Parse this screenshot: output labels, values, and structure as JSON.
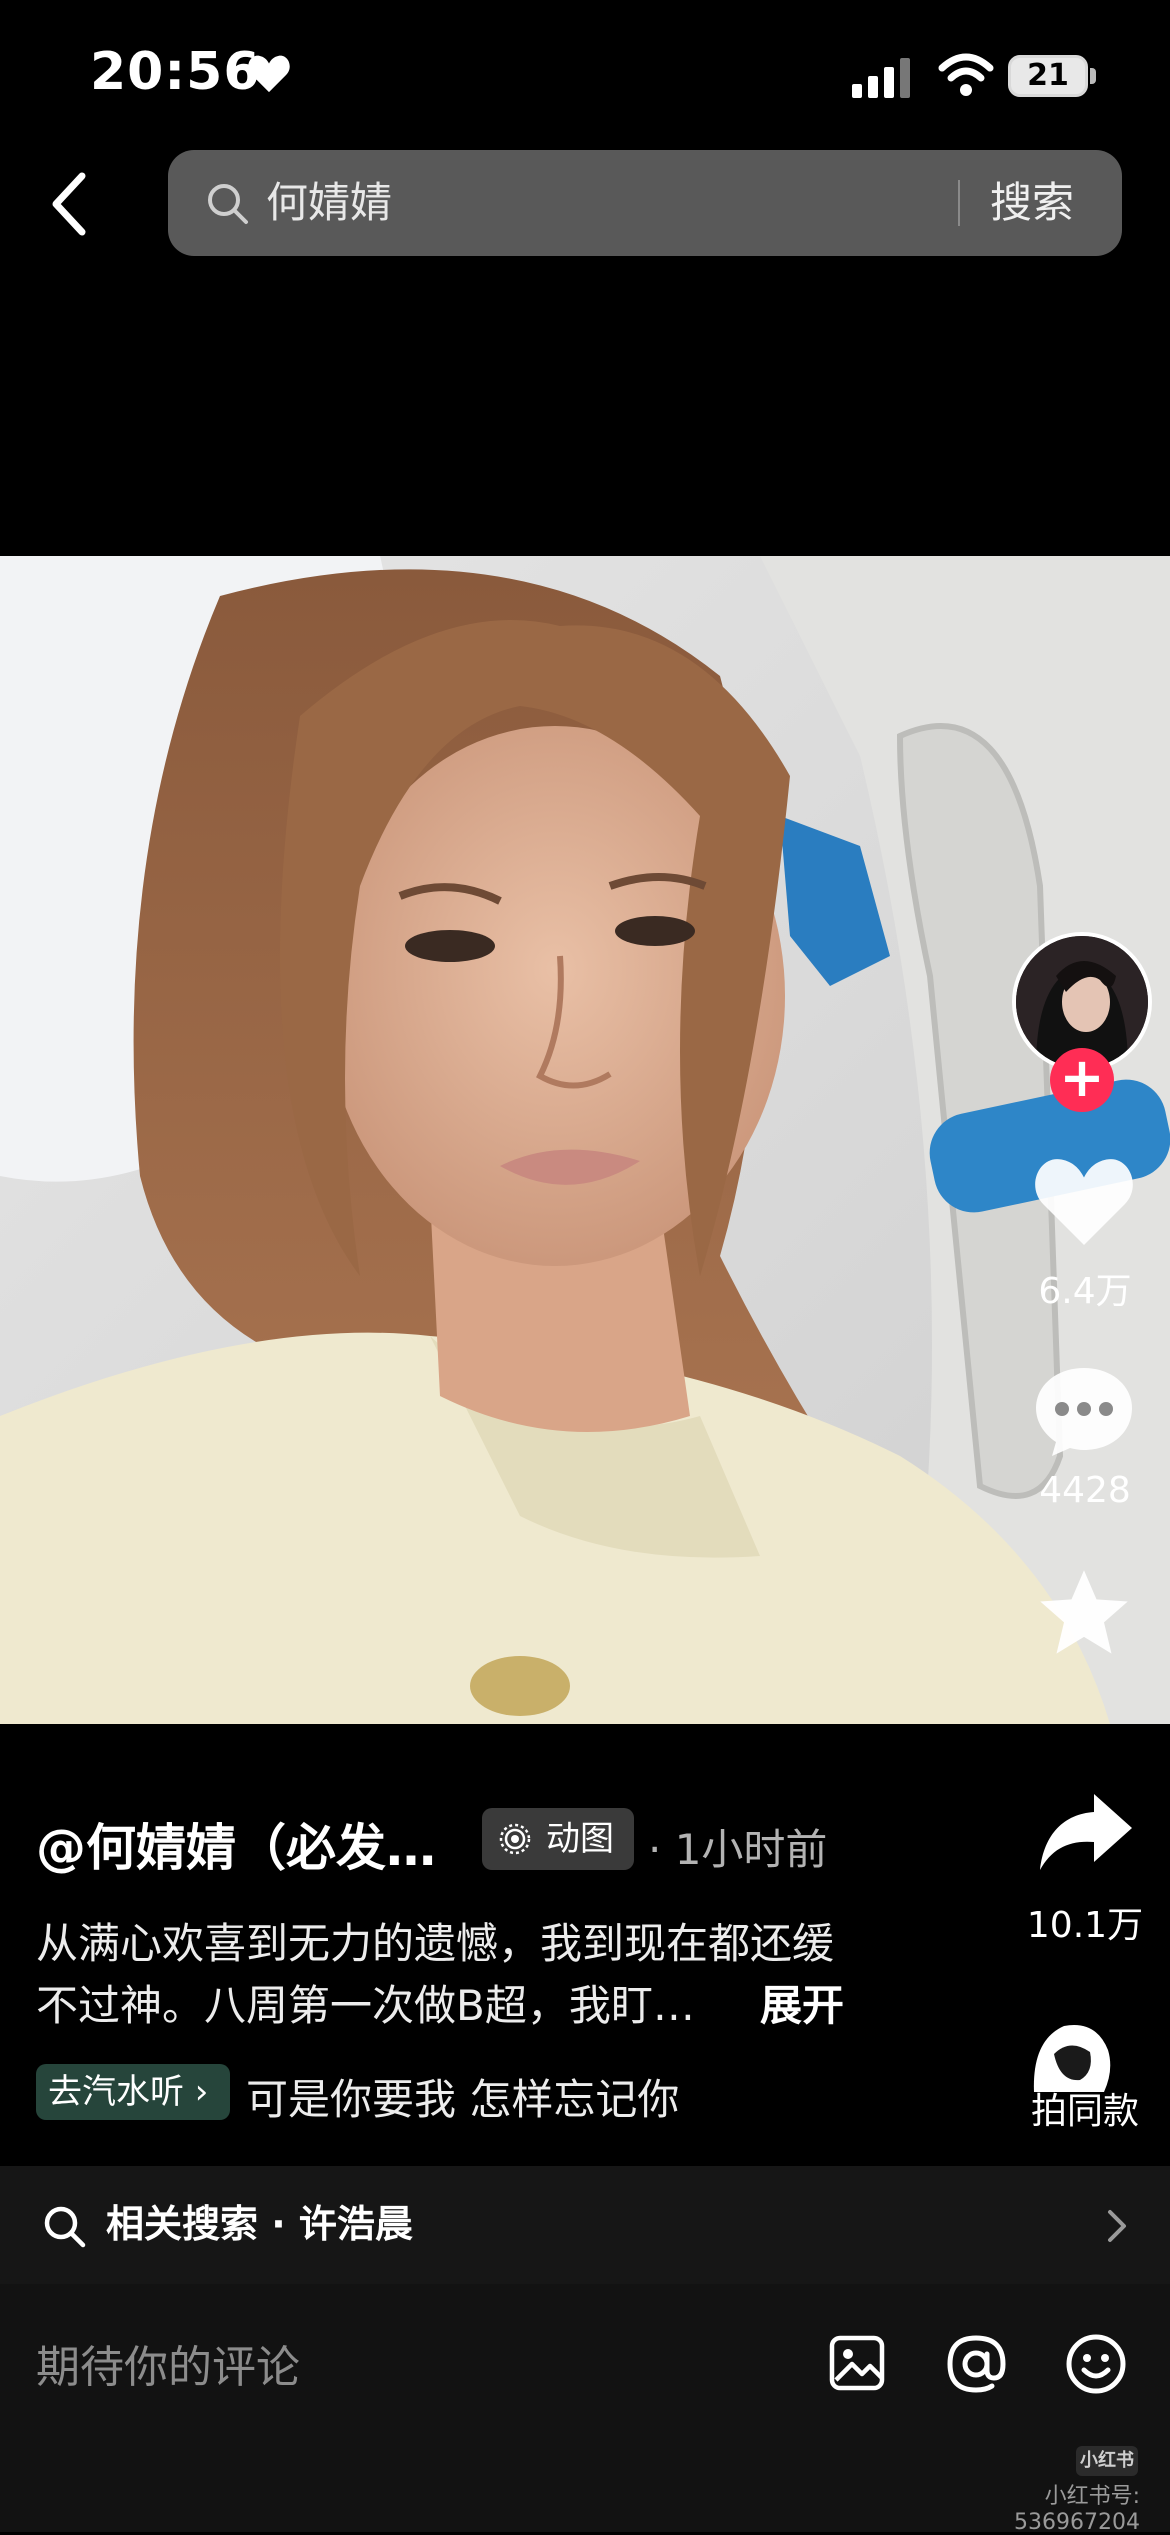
{
  "status_bar": {
    "time": "20:56",
    "battery": "21"
  },
  "search": {
    "query": "何婧婧",
    "button": "搜索"
  },
  "actions": {
    "likes": "6.4万",
    "comments": "4428",
    "shares": "10.1万",
    "same_style": "拍同款"
  },
  "post": {
    "author": "@何婧婧（必发…",
    "badge": "动图",
    "time": "· 1小时前",
    "caption_line1": "从满心欢喜到无力的遗憾，我到现在都还缓",
    "caption_line2": "不过神。八周第一次做B超，我盯…",
    "expand": "展开",
    "music_badge": "去汽水听 ›",
    "song": "可是你要我  怎样忘记你"
  },
  "related": {
    "label": "相关搜索 · 许浩晨"
  },
  "comment": {
    "placeholder": "期待你的评论"
  },
  "watermark": {
    "logo": "小红书",
    "text": "小红书号: 536967204"
  },
  "colors": {
    "follow": "#ff2d55",
    "music_badge": "#26453b",
    "background": "#000000"
  }
}
